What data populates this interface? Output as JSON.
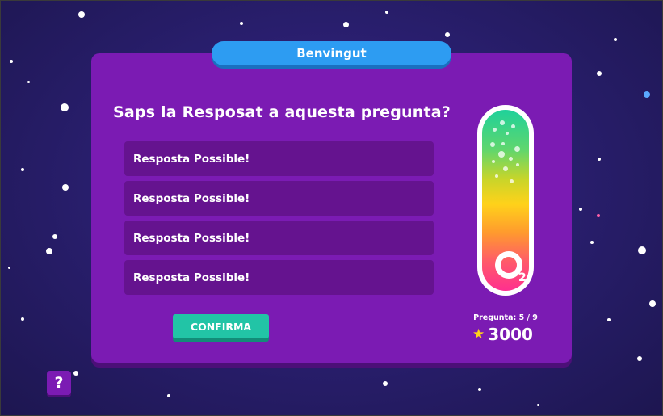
{
  "header": {
    "title": "Benvingut"
  },
  "question": {
    "text": "Saps la Resposat a aquesta pregunta?"
  },
  "answers": [
    {
      "label": "Resposta Possible!"
    },
    {
      "label": "Resposta Possible!"
    },
    {
      "label": "Resposta Possible!"
    },
    {
      "label": "Resposta Possible!"
    }
  ],
  "confirm": {
    "label": "CONFIRMA"
  },
  "oxygen": {
    "symbol_subscript": "2"
  },
  "progress": {
    "label": "Pregunta: 5 / 9"
  },
  "score": {
    "value": "3000",
    "icon": "star-icon"
  },
  "help": {
    "label": "?"
  },
  "colors": {
    "background": "#2a1f70",
    "panel": "#7b1bb3",
    "answer": "#65138f",
    "title_pill": "#2d9cf2",
    "confirm": "#22c4a6",
    "star": "#ffd21a"
  }
}
